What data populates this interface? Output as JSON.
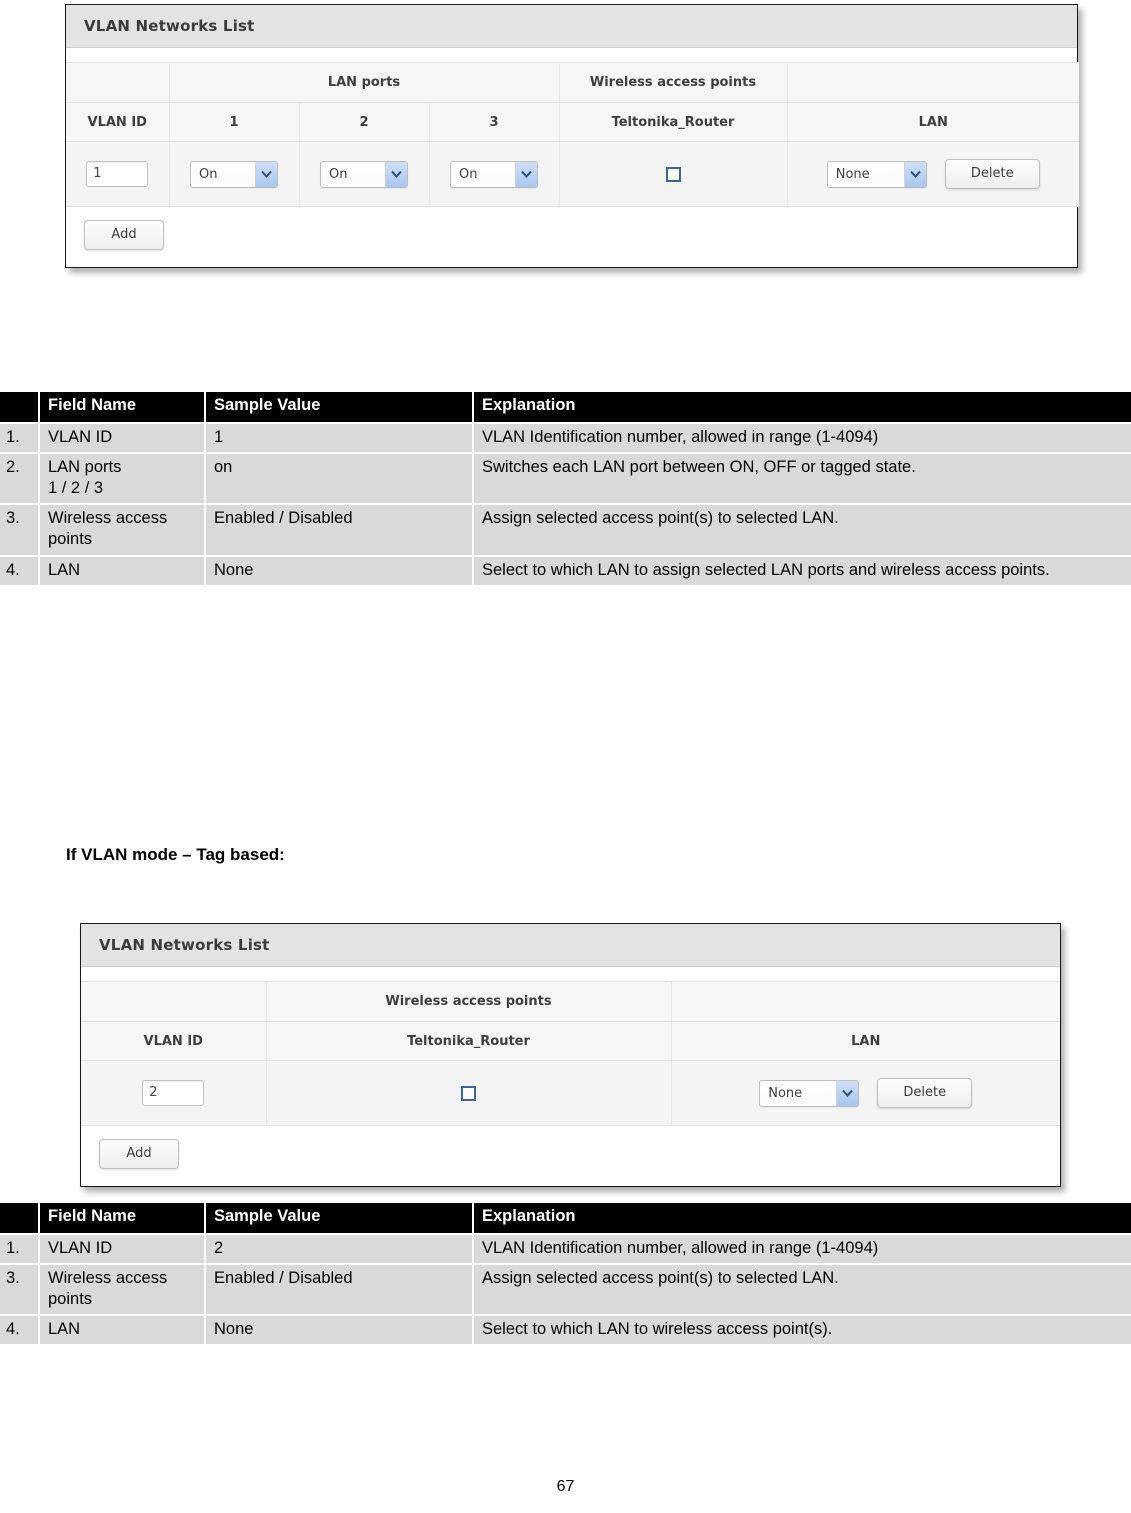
{
  "page": {
    "number": "67"
  },
  "heading_tag_based": "If VLAN mode – Tag based:",
  "widget_port_based": {
    "title": "VLAN Networks List",
    "group_headers": {
      "blank_left": "",
      "lan_ports": "LAN ports",
      "wireless_access_points": "Wireless access points",
      "blank_right": ""
    },
    "column_headers": {
      "vlan_id": "VLAN ID",
      "port1": "1",
      "port2": "2",
      "port3": "3",
      "ap_name": "Teltonika_Router",
      "lan": "LAN"
    },
    "row": {
      "vlan_id_value": "1",
      "port1_value": "On",
      "port2_value": "On",
      "port3_value": "On",
      "ap_checked": false,
      "lan_value": "None",
      "delete_label": "Delete"
    },
    "add_label": "Add"
  },
  "widget_tag_based": {
    "title": "VLAN Networks List",
    "group_headers": {
      "blank_left": "",
      "wireless_access_points": "Wireless access points",
      "blank_right": ""
    },
    "column_headers": {
      "vlan_id": "VLAN ID",
      "ap_name": "Teltonika_Router",
      "lan": "LAN"
    },
    "row": {
      "vlan_id_value": "2",
      "ap_checked": false,
      "lan_value": "None",
      "delete_label": "Delete"
    },
    "add_label": "Add"
  },
  "table_port_based": {
    "headers": {
      "index": "",
      "field_name": "Field Name",
      "sample_value": "Sample Value",
      "explanation": "Explanation"
    },
    "rows": [
      {
        "index": "1.",
        "field_name": "VLAN ID",
        "sample_value": "1",
        "explanation": "VLAN Identification number, allowed in range (1-4094)"
      },
      {
        "index": "2.",
        "field_name": "LAN ports\n 1 / 2 / 3",
        "sample_value": "on",
        "explanation": "Switches each LAN port between ON, OFF or tagged state."
      },
      {
        "index": "3.",
        "field_name": "Wireless access points",
        "sample_value": "Enabled / Disabled",
        "explanation": "Assign selected access point(s) to selected LAN."
      },
      {
        "index": "4.",
        "field_name": "LAN",
        "sample_value": "None",
        "explanation": "Select to which LAN to assign selected LAN ports and wireless access points."
      }
    ]
  },
  "table_tag_based": {
    "headers": {
      "index": "",
      "field_name": "Field Name",
      "sample_value": "Sample Value",
      "explanation": "Explanation"
    },
    "rows": [
      {
        "index": "1.",
        "field_name": "VLAN ID",
        "sample_value": "2",
        "explanation": "VLAN Identification number, allowed in range (1-4094)"
      },
      {
        "index": "3.",
        "field_name": "Wireless access points",
        "sample_value": "Enabled / Disabled",
        "explanation": "Assign selected access point(s) to selected LAN."
      },
      {
        "index": "4.",
        "field_name": "LAN",
        "sample_value": "None",
        "explanation": "Select to which LAN to wireless access point(s)."
      }
    ]
  },
  "colors": {
    "header_black": "#000000",
    "row_grey": "#d9d9d9",
    "widget_title_grey": "#e3e3e3",
    "select_arrow_blue": "#a8c6ef",
    "checkbox_border_blue": "#3d6597"
  }
}
